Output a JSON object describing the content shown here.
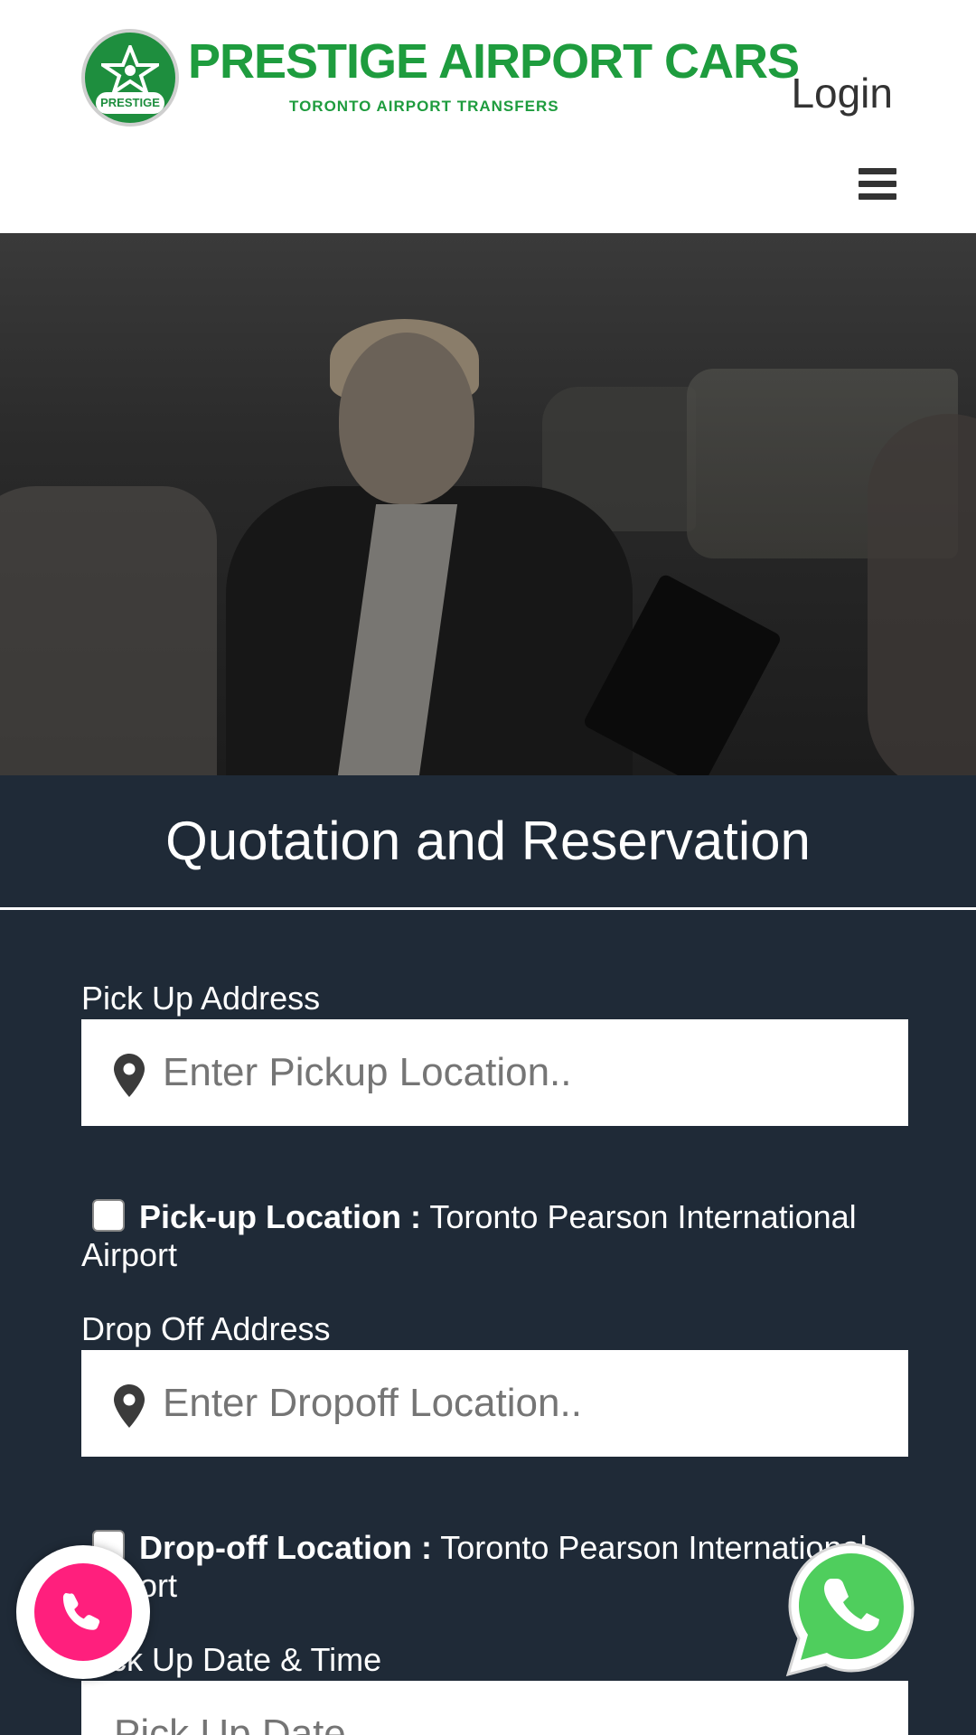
{
  "header": {
    "logo_title": "PRESTIGE AIRPORT CARS",
    "logo_subtitle": "TORONTO  AIRPORT  TRANSFERS",
    "logo_badge": "PRESTIGE",
    "login_label": "Login"
  },
  "form": {
    "title": "Quotation and Reservation",
    "pickup": {
      "label": "Pick Up Address",
      "placeholder": "Enter Pickup Location..",
      "checkbox_label_bold": "Pick-up Location :",
      "checkbox_label_text": " Toronto Pearson International Airport"
    },
    "dropoff": {
      "label": "Drop Off Address",
      "placeholder": "Enter Dropoff Location..",
      "checkbox_label_bold": "Drop-off Location :",
      "checkbox_label_text": " Toronto Pearson International Airport"
    },
    "datetime": {
      "label": "Pick Up Date & Time",
      "placeholder": "Pick Up Date"
    }
  },
  "colors": {
    "brand_green": "#1e9c3e",
    "form_bg": "#1f2a37",
    "call_button": "#ff1f7d",
    "whatsapp": "#4fce5d"
  },
  "icons": [
    "car-logo-icon",
    "hamburger-menu-icon",
    "map-pin-icon",
    "phone-icon",
    "whatsapp-icon"
  ]
}
